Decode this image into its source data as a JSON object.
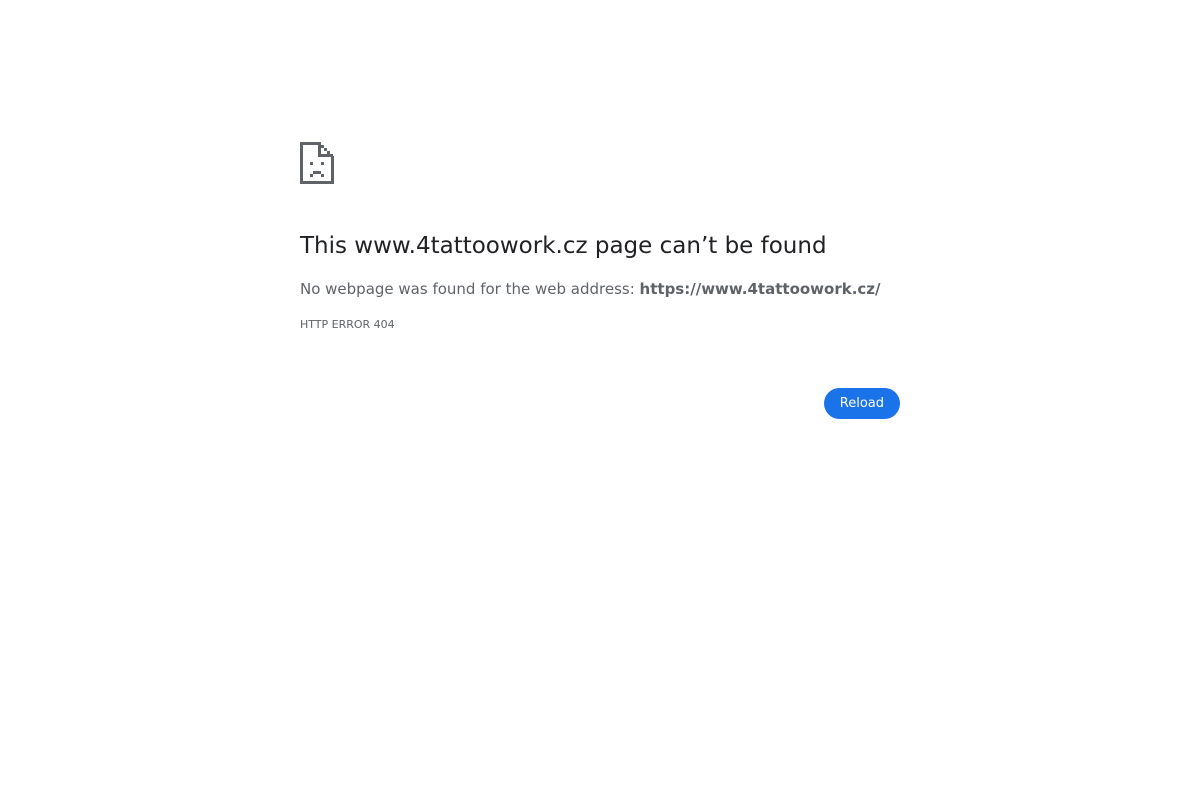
{
  "icon": "sad-document-icon",
  "title": "This www.4tattoowork.cz page can’t be found",
  "description": {
    "prefix": "No webpage was found for the web address: ",
    "url": "https://www.4tattoowork.cz/"
  },
  "error_code": "HTTP ERROR 404",
  "reload_button": {
    "label": "Reload",
    "color": "#1a73e8"
  }
}
